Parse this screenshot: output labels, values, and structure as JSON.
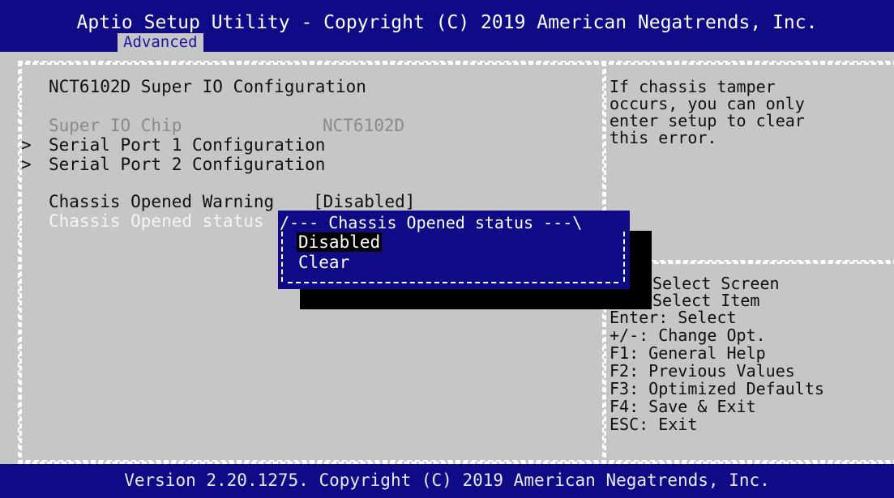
{
  "header": {
    "title": "Aptio Setup Utility - Copyright (C) 2019 American Negatrends, Inc.",
    "active_tab": "Advanced"
  },
  "main": {
    "heading": "NCT6102D Super IO Configuration",
    "chip_label": "Super IO Chip",
    "chip_value": "NCT6102D",
    "submenus": [
      {
        "arrow": ">",
        "label": "Serial Port 1 Configuration"
      },
      {
        "arrow": ">",
        "label": "Serial Port 2 Configuration"
      }
    ],
    "warning_label": "Chassis Opened Warning",
    "warning_value": "[Disabled]",
    "status_label": "Chassis Opened status"
  },
  "popup": {
    "title": "/--- Chassis Opened status ---\\",
    "options": [
      {
        "label": "Disabled",
        "selected": true
      },
      {
        "label": "Clear",
        "selected": false
      }
    ]
  },
  "help": {
    "description": "If chassis tamper\noccurs, you can only\nenter setup to clear\nthis error.",
    "keys": [
      "Select Screen",
      "Select Item",
      "Enter: Select",
      "+/-: Change Opt.",
      "F1: General Help",
      "F2: Previous Values",
      "F3: Optimized Defaults",
      "F4: Save & Exit",
      "ESC: Exit"
    ]
  },
  "footer": {
    "text": "Version 2.20.1275. Copyright (C) 2019 American Negatrends, Inc."
  },
  "colors": {
    "bios_blue": "#0f0a86",
    "panel_gray": "#c6c6c6",
    "text_black": "#101010",
    "text_disabled": "#8a8a8a",
    "text_highlight": "#ffffff"
  }
}
